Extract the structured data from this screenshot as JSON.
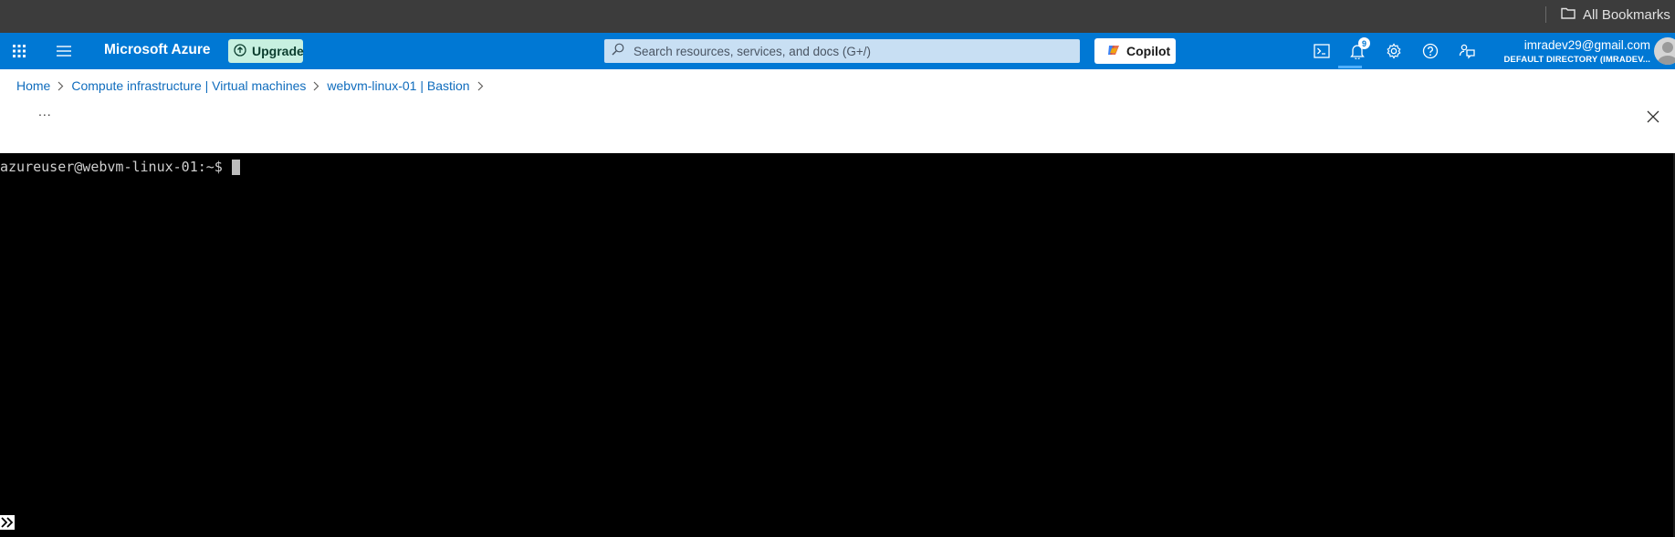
{
  "bookmarks_bar": {
    "all_bookmarks_label": "All Bookmarks",
    "icon": "folder-icon"
  },
  "topbar": {
    "brand": "Microsoft Azure",
    "upgrade_label": "Upgrade",
    "search_placeholder": "Search resources, services, and docs (G+/)",
    "copilot_label": "Copilot",
    "notifications_count": "9",
    "icons": [
      "waffle-icon",
      "hamburger-icon",
      "cloud-shell-icon",
      "bell-icon",
      "gear-icon",
      "help-icon",
      "feedback-icon"
    ],
    "account": {
      "email": "imradev29@gmail.com",
      "directory": "DEFAULT DIRECTORY (IMRADEV..."
    },
    "colors": {
      "bar": "#0078d4",
      "upgrade_bg": "#c7f0e0",
      "search_bg": "#c8dff3"
    }
  },
  "breadcrumb": {
    "items": [
      "Home",
      "Compute infrastructure | Virtual machines",
      "webvm-linux-01 | Bastion"
    ]
  },
  "toolbar": {
    "more_label": "..."
  },
  "terminal": {
    "prompt": "azureuser@webvm-linux-01:~$",
    "background": "#000000",
    "text_color": "#cfcfcf"
  }
}
